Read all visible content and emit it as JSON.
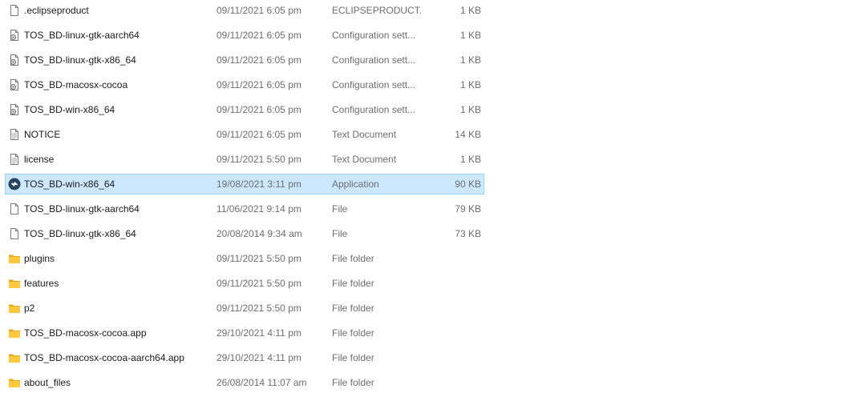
{
  "files": [
    {
      "name": ".eclipseproduct",
      "date": "09/11/2021 6:05 pm",
      "type": "ECLIPSEPRODUCT...",
      "size": "1 KB",
      "icon": "blank-file-icon"
    },
    {
      "name": "TOS_BD-linux-gtk-aarch64",
      "date": "09/11/2021 6:05 pm",
      "type": "Configuration sett...",
      "size": "1 KB",
      "icon": "config-file-icon"
    },
    {
      "name": "TOS_BD-linux-gtk-x86_64",
      "date": "09/11/2021 6:05 pm",
      "type": "Configuration sett...",
      "size": "1 KB",
      "icon": "config-file-icon"
    },
    {
      "name": "TOS_BD-macosx-cocoa",
      "date": "09/11/2021 6:05 pm",
      "type": "Configuration sett...",
      "size": "1 KB",
      "icon": "config-file-icon"
    },
    {
      "name": "TOS_BD-win-x86_64",
      "date": "09/11/2021 6:05 pm",
      "type": "Configuration sett...",
      "size": "1 KB",
      "icon": "config-file-icon"
    },
    {
      "name": "NOTICE",
      "date": "09/11/2021 6:05 pm",
      "type": "Text Document",
      "size": "14 KB",
      "icon": "text-document-icon"
    },
    {
      "name": "license",
      "date": "09/11/2021 5:50 pm",
      "type": "Text Document",
      "size": "1 KB",
      "icon": "text-document-icon"
    },
    {
      "name": "TOS_BD-win-x86_64",
      "date": "19/08/2021 3:11 pm",
      "type": "Application",
      "size": "90 KB",
      "icon": "application-icon",
      "selected": true
    },
    {
      "name": "TOS_BD-linux-gtk-aarch64",
      "date": "11/06/2021 9:14 pm",
      "type": "File",
      "size": "79 KB",
      "icon": "blank-file-icon"
    },
    {
      "name": "TOS_BD-linux-gtk-x86_64",
      "date": "20/08/2014 9:34 am",
      "type": "File",
      "size": "73 KB",
      "icon": "blank-file-icon"
    },
    {
      "name": "plugins",
      "date": "09/11/2021 5:50 pm",
      "type": "File folder",
      "size": "",
      "icon": "folder-icon"
    },
    {
      "name": "features",
      "date": "09/11/2021 5:50 pm",
      "type": "File folder",
      "size": "",
      "icon": "folder-icon"
    },
    {
      "name": "p2",
      "date": "09/11/2021 5:50 pm",
      "type": "File folder",
      "size": "",
      "icon": "folder-icon"
    },
    {
      "name": "TOS_BD-macosx-cocoa.app",
      "date": "29/10/2021 4:11 pm",
      "type": "File folder",
      "size": "",
      "icon": "folder-icon"
    },
    {
      "name": "TOS_BD-macosx-cocoa-aarch64.app",
      "date": "29/10/2021 4:11 pm",
      "type": "File folder",
      "size": "",
      "icon": "folder-icon"
    },
    {
      "name": "about_files",
      "date": "26/08/2014 11:07 am",
      "type": "File folder",
      "size": "",
      "icon": "folder-icon"
    }
  ],
  "colors": {
    "selection_background": "#cce8ff",
    "selection_border": "#99d1ff",
    "folder": "#ffc83d",
    "secondary_text": "#6d6d6d"
  }
}
